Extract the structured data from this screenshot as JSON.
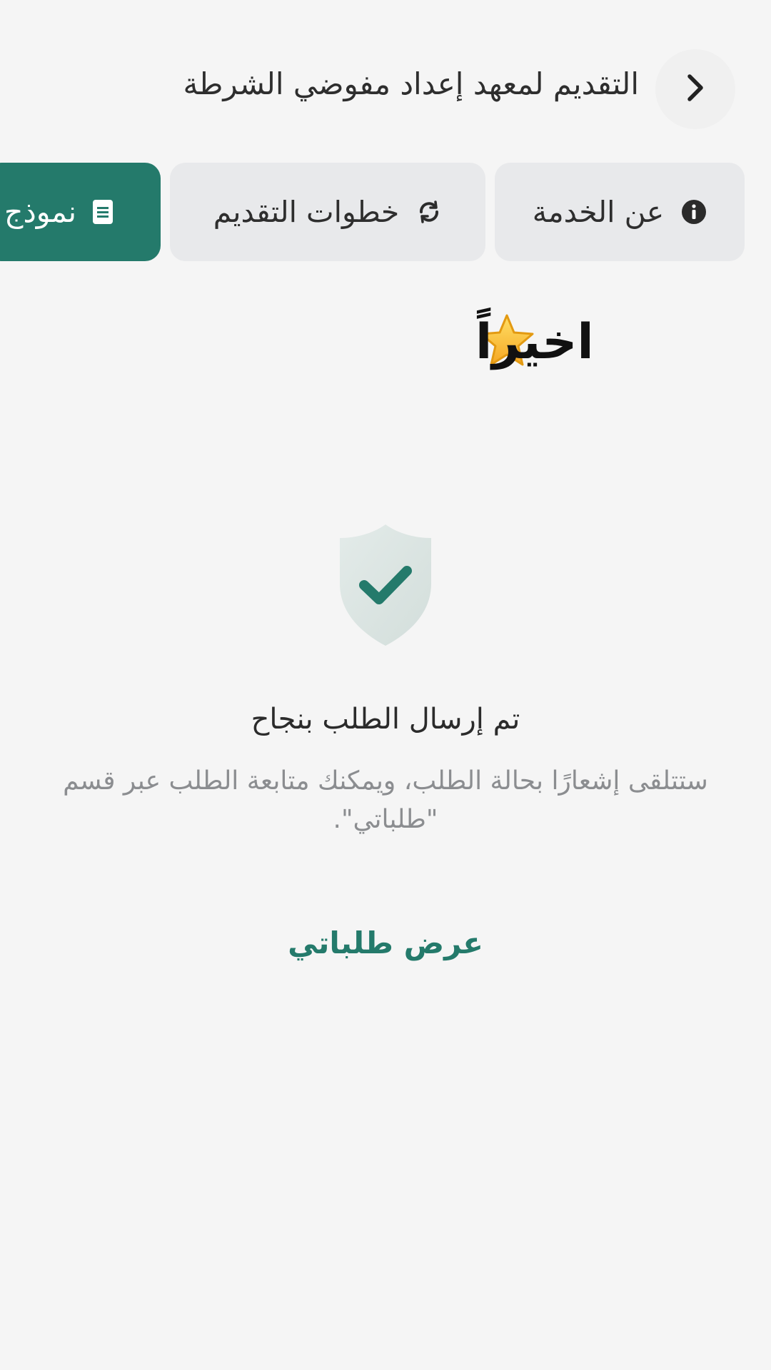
{
  "header": {
    "title": "التقديم لمعهد إعداد مفوضي الشرطة",
    "back_icon": "chevron-right-icon"
  },
  "tabs": [
    {
      "label": "عن الخدمة",
      "icon": "info-icon"
    },
    {
      "label": "خطوات التقديم",
      "icon": "refresh-icon"
    },
    {
      "label": "نموذج",
      "icon": "document-icon",
      "active": true
    }
  ],
  "heading": {
    "text": "اخيراً",
    "icon": "star-icon"
  },
  "success": {
    "icon": "shield-check-icon",
    "title": "تم إرسال الطلب بنجاح",
    "description": "ستتلقى إشعارًا بحالة الطلب، ويمكنك متابعة الطلب عبر قسم \"طلباتي\".",
    "view_link": "عرض طلباتي"
  },
  "colors": {
    "accent": "#247a6b",
    "background": "#f5f5f5",
    "tab_bg": "#e8e9eb",
    "muted_text": "#8b8d90"
  }
}
